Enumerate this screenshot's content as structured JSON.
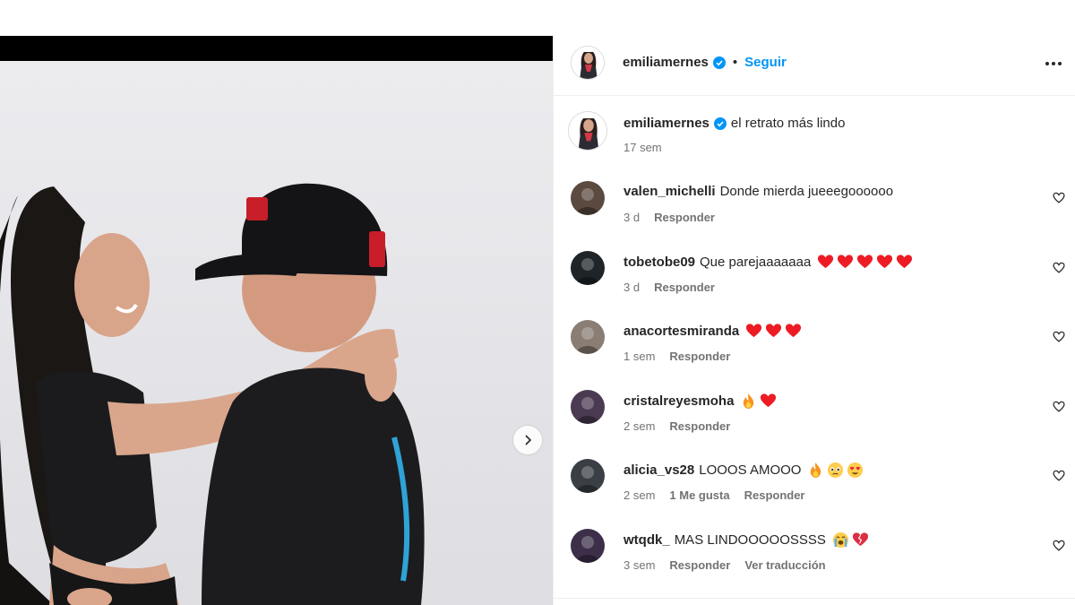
{
  "post": {
    "author": "emiliamernes",
    "follow_label": "Seguir",
    "separator": "•",
    "more_icon": "more-horizontal-icon",
    "caption_text": "el retrato más lindo",
    "caption_time": "17 sem"
  },
  "comments": [
    {
      "user": "valen_michelli",
      "text": "Donde mierda jueeegoooooo",
      "emojis": [],
      "time": "3 d",
      "likes": "",
      "reply": "Responder",
      "translate": "",
      "avatar_color": "#5b4a3f"
    },
    {
      "user": "tobetobe09",
      "text": "Que parejaaaaaaa",
      "emojis": [
        "heart",
        "heart",
        "heart",
        "heart",
        "heart"
      ],
      "time": "3 d",
      "likes": "",
      "reply": "Responder",
      "translate": "",
      "avatar_color": "#1e2428"
    },
    {
      "user": "anacortesmiranda",
      "text": "",
      "emojis": [
        "heart",
        "heart",
        "heart"
      ],
      "time": "1 sem",
      "likes": "",
      "reply": "Responder",
      "translate": "",
      "avatar_color": "#8a7d74"
    },
    {
      "user": "cristalreyesmoha",
      "text": "",
      "emojis": [
        "fire",
        "heart"
      ],
      "time": "2 sem",
      "likes": "",
      "reply": "Responder",
      "translate": "",
      "avatar_color": "#4a3a52"
    },
    {
      "user": "alicia_vs28",
      "text": "LOOOS AMOOO",
      "emojis": [
        "fire",
        "pleading",
        "heart-eyes"
      ],
      "time": "2 sem",
      "likes": "1 Me gusta",
      "reply": "Responder",
      "translate": "",
      "avatar_color": "#3a3f45"
    },
    {
      "user": "wtqdk_",
      "text": " MAS LINDOOOOOSSSS",
      "emojis": [
        "crying",
        "broken-heart"
      ],
      "time": "3 sem",
      "likes": "",
      "reply": "Responder",
      "translate": "Ver traducción",
      "avatar_color": "#3d2f4a"
    }
  ],
  "colors": {
    "accent": "#0095f6",
    "verified": "#0095f6",
    "heart": "#ed1c24"
  }
}
